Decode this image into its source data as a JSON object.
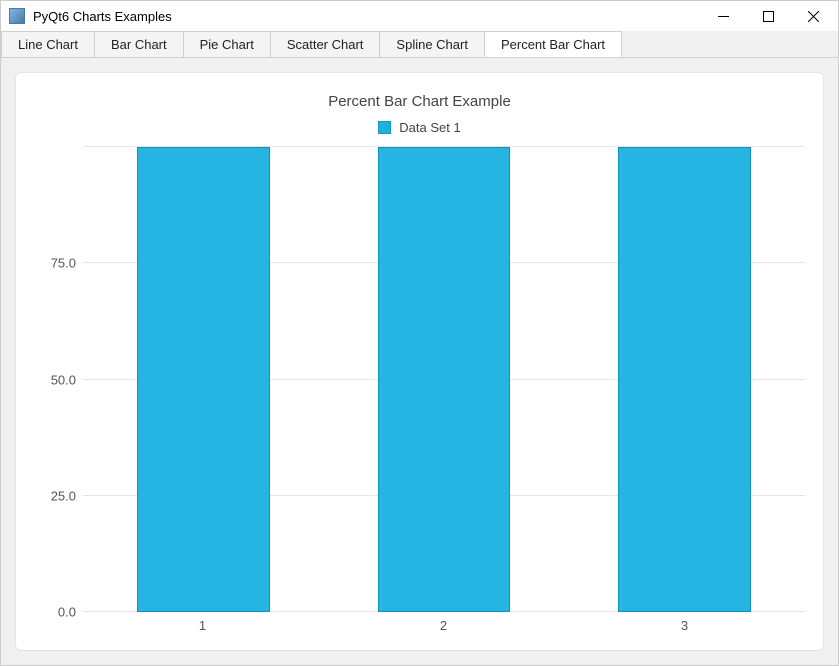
{
  "window": {
    "title": "PyQt6 Charts Examples"
  },
  "tabs": [
    {
      "label": "Line Chart",
      "active": false
    },
    {
      "label": "Bar Chart",
      "active": false
    },
    {
      "label": "Pie Chart",
      "active": false
    },
    {
      "label": "Scatter Chart",
      "active": false
    },
    {
      "label": "Spline Chart",
      "active": false
    },
    {
      "label": "Percent Bar Chart",
      "active": true
    }
  ],
  "chart": {
    "title": "Percent Bar Chart Example",
    "legend": {
      "series_name": "Data Set 1",
      "color": "#26b4e3"
    }
  },
  "chart_data": {
    "type": "bar",
    "title": "Percent Bar Chart Example",
    "series": [
      {
        "name": "Data Set 1",
        "values": [
          100,
          100,
          100
        ],
        "color": "#26b4e3"
      }
    ],
    "categories": [
      "1",
      "2",
      "3"
    ],
    "xlabel": "",
    "ylabel": "",
    "ylim": [
      0,
      100
    ],
    "y_ticks": [
      0.0,
      25.0,
      50.0,
      75.0
    ],
    "y_tick_labels": [
      "0.0",
      "25.0",
      "50.0",
      "75.0"
    ],
    "grid": true,
    "legend_position": "top"
  }
}
